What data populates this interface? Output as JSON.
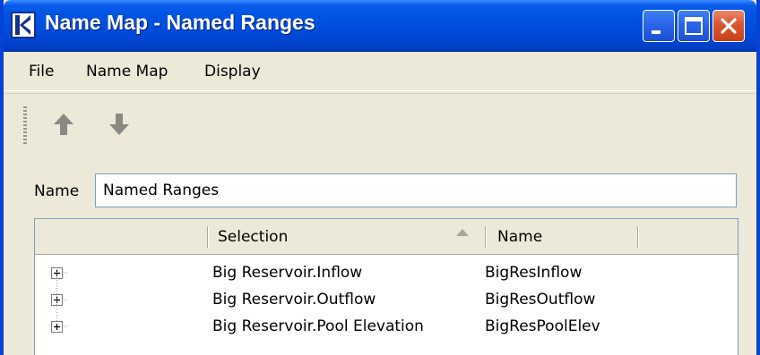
{
  "window": {
    "title": "Name Map - Named Ranges",
    "accent": "#0054E3"
  },
  "menu": {
    "file": "File",
    "name_map": "Name Map",
    "display": "Display"
  },
  "toolbar": {
    "move_up_icon": "arrow-up-icon",
    "move_down_icon": "arrow-down-icon"
  },
  "name_field": {
    "label": "Name",
    "value": "Named Ranges"
  },
  "table": {
    "columns": [
      "Selection",
      "Name"
    ],
    "sort_column": "Selection",
    "rows": [
      {
        "selection": "Big Reservoir.Inflow",
        "name": "BigResInflow"
      },
      {
        "selection": "Big Reservoir.Outflow",
        "name": "BigResOutflow"
      },
      {
        "selection": "Big Reservoir.Pool Elevation",
        "name": "BigResPoolElev"
      }
    ]
  }
}
